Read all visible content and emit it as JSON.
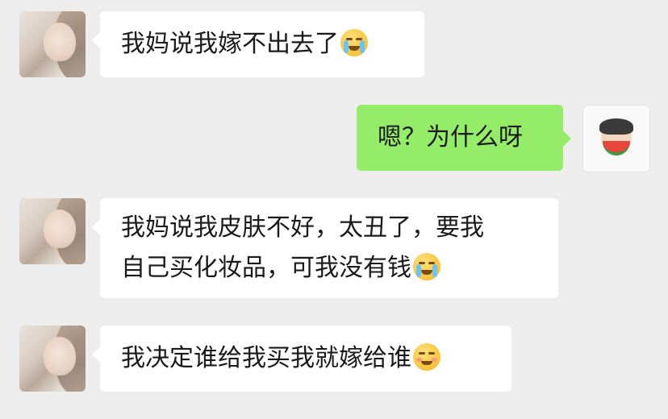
{
  "chat": {
    "messages": [
      {
        "side": "left",
        "lines": [
          "我妈说我嫁不出去了"
        ],
        "emoji": "crying-face-icon"
      },
      {
        "side": "right",
        "lines": [
          "嗯？为什么呀"
        ],
        "emoji": null
      },
      {
        "side": "left",
        "lines": [
          "我妈说我皮肤不好，太丑了，要我",
          "自己买化妆品，可我没有钱"
        ],
        "emoji": "crying-face-icon"
      },
      {
        "side": "left",
        "lines": [
          "我决定谁给我买我就嫁给谁"
        ],
        "emoji": "smiling-face-icon"
      }
    ]
  },
  "colors": {
    "background": "#ededed",
    "incoming_bubble": "#ffffff",
    "outgoing_bubble": "#95ec69"
  }
}
